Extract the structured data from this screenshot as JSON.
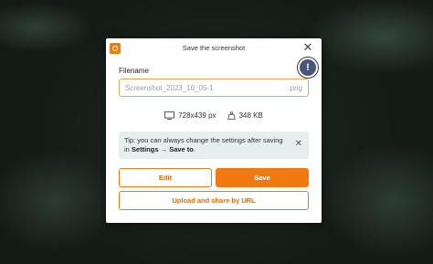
{
  "dialog": {
    "title": "Save the screenshot",
    "close_glyph": "✕"
  },
  "filename": {
    "label": "Filename",
    "value": "Screenshot_2023_10_05-1",
    "extension": ".png"
  },
  "alert": {
    "glyph": "!"
  },
  "meta": {
    "dimensions": "728x439 px",
    "size": "348 KB"
  },
  "tip": {
    "text_prefix": "Tip: you can always change the settings after saving in ",
    "settings": "Settings",
    "arrow": " → ",
    "save_to": "Save to",
    "suffix": ".",
    "close_glyph": "✕"
  },
  "buttons": {
    "edit": "Edit",
    "save": "Save",
    "upload": "Upload and share by URL"
  },
  "colors": {
    "accent": "#f07a12",
    "tip_bg": "#e6eeee"
  }
}
